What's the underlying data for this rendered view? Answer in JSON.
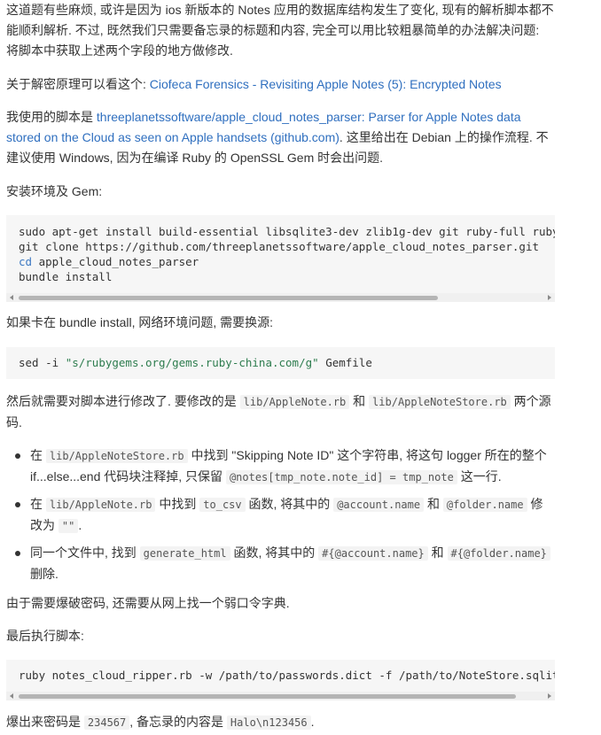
{
  "p1": {
    "text": "这道题有些麻烦, 或许是因为 ios 新版本的 Notes 应用的数据库结构发生了变化, 现有的解析脚本都不能顺利解析. 不过, 既然我们只需要备忘录的标题和内容, 完全可以用比较粗暴简单的办法解决问题: 将脚本中获取上述两个字段的地方做修改."
  },
  "p2": {
    "prefix": "关于解密原理可以看这个: ",
    "link": "Ciofeca Forensics - Revisiting Apple Notes (5): Encrypted Notes"
  },
  "p3": {
    "prefix": "我使用的脚本是 ",
    "link": "threeplanetssoftware/apple_cloud_notes_parser: Parser for Apple Notes data stored on the Cloud as seen on Apple handsets (github.com)",
    "suffix": ". 这里给出在 Debian 上的操作流程. 不建议使用 Windows, 因为在编译 Ruby 的 OpenSSL Gem 时会出问题."
  },
  "p4": {
    "text": "安装环境及 Gem:"
  },
  "code1": {
    "line1": "sudo apt-get install build-essential libsqlite3-dev zlib1g-dev git ruby-full ruby-b",
    "line2": "git clone https://github.com/threeplanetssoftware/apple_cloud_notes_parser.git",
    "line3_kw": "cd",
    "line3_rest": " apple_cloud_notes_parser",
    "line4": "bundle install",
    "scroll_fraction": 0.8
  },
  "p5": {
    "text": "如果卡在 bundle install, 网络环境问题, 需要换源:"
  },
  "code2": {
    "cmd": "sed -i ",
    "str": "\"s/rubygems.org/gems.ruby-china.com/g\"",
    "rest": " Gemfile"
  },
  "p6": {
    "t1": "然后就需要对脚本进行修改了. 要修改的是 ",
    "c1": "lib/AppleNote.rb",
    "t2": " 和 ",
    "c2": "lib/AppleNoteStore.rb",
    "t3": " 两个源码."
  },
  "list": [
    {
      "t1": "在 ",
      "c1": "lib/AppleNoteStore.rb",
      "t2": " 中找到 \"Skipping Note ID\" 这个字符串, 将这句 logger 所在的整个 if...else...end 代码块注释掉, 只保留 ",
      "c2": "@notes[tmp_note.note_id] = tmp_note",
      "t3": " 这一行."
    },
    {
      "t1": "在 ",
      "c1": "lib/AppleNote.rb",
      "t2": " 中找到 ",
      "c2": "to_csv",
      "t3": " 函数, 将其中的 ",
      "c3": "@account.name",
      "t4": " 和 ",
      "c4": "@folder.name",
      "t5": " 修改为 ",
      "c5": "\"\"",
      "t6": "."
    },
    {
      "t1": "同一个文件中, 找到 ",
      "c1": "generate_html",
      "t2": " 函数, 将其中的 ",
      "c2": "#{@account.name}",
      "t3": " 和 ",
      "c3": "#{@folder.name}",
      "t4": " 删除."
    }
  ],
  "p7": {
    "text": "由于需要爆破密码, 还需要从网上找一个弱口令字典."
  },
  "p8": {
    "text": "最后执行脚本:"
  },
  "code3": {
    "line": "ruby notes_cloud_ripper.rb -w /path/to/passwords.dict -f /path/to/NoteStore.sqlite",
    "scroll_fraction": 0.95
  },
  "p9": {
    "t1": "爆出来密码是 ",
    "c1": "234567",
    "t2": ", 备忘录的内容是 ",
    "c2": "Halo\\n123456",
    "t3": "."
  }
}
